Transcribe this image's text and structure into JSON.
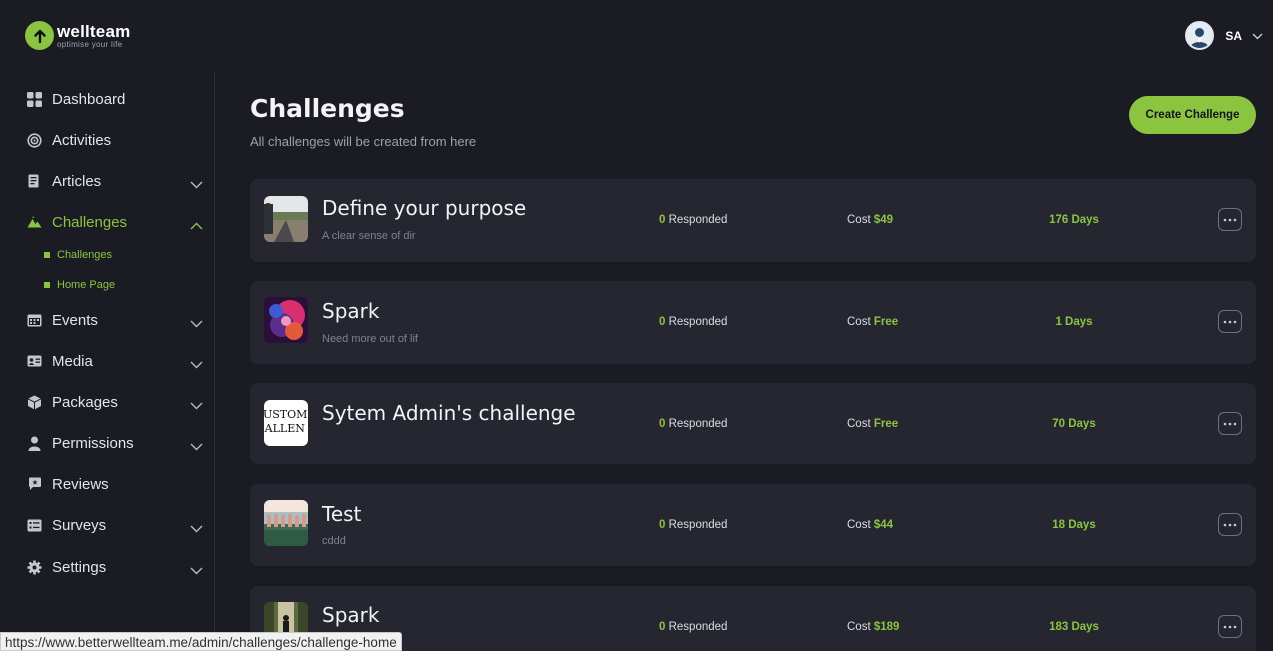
{
  "brand": {
    "name": "wellteam",
    "tagline": "optimise your life",
    "accent": "#8bc53f"
  },
  "user": {
    "initials": "SA"
  },
  "sidebar": {
    "items": [
      {
        "label": "Dashboard",
        "icon": "dashboard-grid-icon"
      },
      {
        "label": "Activities",
        "icon": "target-icon"
      },
      {
        "label": "Articles",
        "icon": "article-icon"
      },
      {
        "label": "Challenges",
        "icon": "mountain-icon"
      },
      {
        "label": "Events",
        "icon": "calendar-icon"
      },
      {
        "label": "Media",
        "icon": "media-card-icon"
      },
      {
        "label": "Packages",
        "icon": "package-icon"
      },
      {
        "label": "Permissions",
        "icon": "user-icon"
      },
      {
        "label": "Reviews",
        "icon": "review-bubble-icon"
      },
      {
        "label": "Surveys",
        "icon": "survey-icon"
      },
      {
        "label": "Settings",
        "icon": "gear-icon"
      }
    ],
    "challenges_sub": [
      {
        "label": "Challenges"
      },
      {
        "label": "Home Page"
      }
    ]
  },
  "main": {
    "title": "Challenges",
    "subtitle": "All challenges will be created from here",
    "create_button": "Create Challenge"
  },
  "challenges": [
    {
      "title": "Define your purpose",
      "desc": "A clear sense of dir",
      "responded": "0",
      "responded_label": "Responded",
      "cost_label": "Cost",
      "cost": "$49",
      "days": "176 Days",
      "thumb": "road-photo"
    },
    {
      "title": "Spark",
      "desc": "Need more out of lif",
      "responded": "0",
      "responded_label": "Responded",
      "cost_label": "Cost",
      "cost": "Free",
      "days": "1 Days",
      "thumb": "neon-face-photo"
    },
    {
      "title": "Sytem Admin's challenge",
      "desc": "",
      "responded": "0",
      "responded_label": "Responded",
      "cost_label": "Cost",
      "cost": "Free",
      "days": "70 Days",
      "thumb": "custom-challenge-text",
      "thumb_text_1": "CUSTOM",
      "thumb_text_2": "HALLEN"
    },
    {
      "title": "Test",
      "desc": "cddd",
      "responded": "0",
      "responded_label": "Responded",
      "cost_label": "Cost",
      "cost": "$44",
      "days": "18 Days",
      "thumb": "beach-group-photo"
    },
    {
      "title": "Spark",
      "desc": "",
      "responded": "0",
      "responded_label": "Responded",
      "cost_label": "Cost",
      "cost": "$189",
      "days": "183 Days",
      "thumb": "forest-runner-photo"
    }
  ],
  "status_bar": {
    "url": "https://www.betterwellteam.me/admin/challenges/challenge-home"
  }
}
